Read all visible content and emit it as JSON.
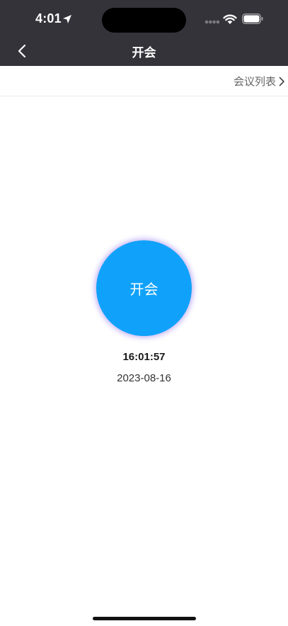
{
  "status_bar": {
    "time": "4:01"
  },
  "nav": {
    "title": "开会"
  },
  "subbar": {
    "meeting_list_label": "会议列表"
  },
  "main": {
    "start_button_label": "开会",
    "current_time": "16:01:57",
    "current_date": "2023-08-16"
  },
  "colors": {
    "header_bg": "#34333a",
    "accent_blue": "#10a2fb",
    "glow_purple": "#8c6eeb"
  }
}
